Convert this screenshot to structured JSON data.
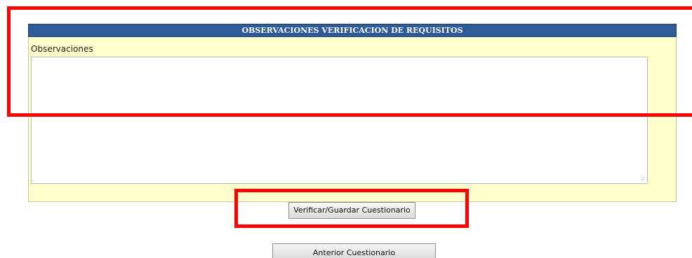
{
  "panel": {
    "title": "OBSERVACIONES VERIFICACION DE REQUISITOS",
    "observations_label": "Observaciones",
    "observations_value": ""
  },
  "actions": {
    "verify_save_label": "Verificar/Guardar Cuestionario",
    "previous_label": "Anterior Cuestionario"
  },
  "colors": {
    "header_bg": "#2f5c99",
    "panel_bg": "#ffffcc",
    "highlight": "#ff0000"
  }
}
